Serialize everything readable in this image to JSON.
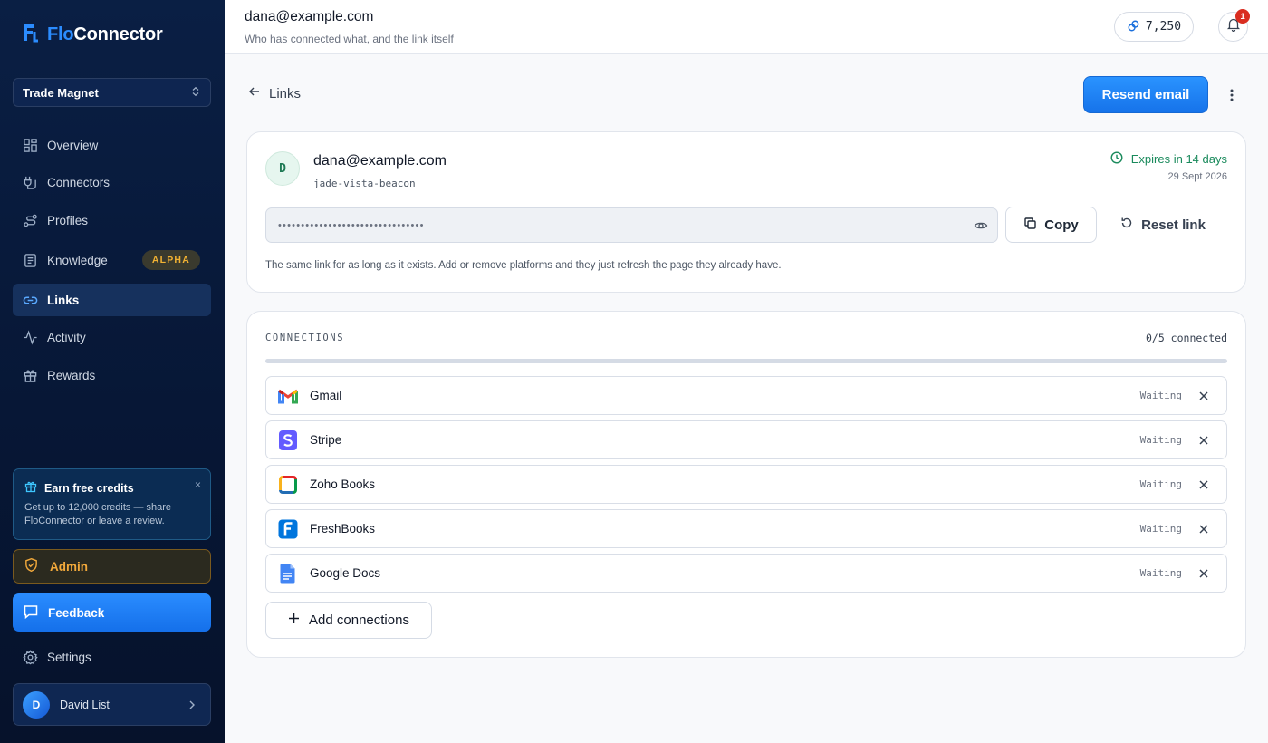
{
  "app": {
    "name_part1": "Flo",
    "name_part2": "Connector"
  },
  "sidebar": {
    "org": "Trade Magnet",
    "items": [
      {
        "label": "Overview",
        "icon": "grid-icon"
      },
      {
        "label": "Connectors",
        "icon": "plug-icon"
      },
      {
        "label": "Profiles",
        "icon": "route-icon"
      },
      {
        "label": "Knowledge",
        "icon": "book-icon",
        "badge": "ALPHA"
      },
      {
        "label": "Links",
        "icon": "link-icon",
        "active": true
      },
      {
        "label": "Activity",
        "icon": "activity-icon"
      },
      {
        "label": "Rewards",
        "icon": "gift-icon"
      }
    ],
    "credits_card": {
      "title": "Earn free credits",
      "body": "Get up to 12,000 credits — share FloConnector or leave a review."
    },
    "admin_label": "Admin",
    "feedback_label": "Feedback",
    "settings_label": "Settings",
    "user": {
      "initial": "D",
      "name": "David List"
    }
  },
  "topbar": {
    "title": "dana@example.com",
    "subtitle": "Who has connected what, and the link itself",
    "credits": "7,250",
    "notification_count": "1"
  },
  "main": {
    "back_label": "Links",
    "resend_label": "Resend email",
    "link_card": {
      "initial": "D",
      "email": "dana@example.com",
      "slug": "jade-vista-beacon",
      "expires_label": "Expires in 14 days",
      "expires_date": "29 Sept 2026",
      "secret_mask": "••••••••••••••••••••••••••••••••",
      "copy_label": "Copy",
      "reset_label": "Reset link",
      "help_text": "The same link for as long as it exists. Add or remove platforms and they just refresh the page they already have."
    },
    "connections": {
      "title": "CONNECTIONS",
      "count_label": "0/5 connected",
      "progress_fraction": 0,
      "items": [
        {
          "name": "Gmail",
          "status": "Waiting",
          "icon": "gmail-icon"
        },
        {
          "name": "Stripe",
          "status": "Waiting",
          "icon": "stripe-icon"
        },
        {
          "name": "Zoho Books",
          "status": "Waiting",
          "icon": "zoho-books-icon"
        },
        {
          "name": "FreshBooks",
          "status": "Waiting",
          "icon": "freshbooks-icon"
        },
        {
          "name": "Google Docs",
          "status": "Waiting",
          "icon": "google-docs-icon"
        }
      ],
      "add_label": "Add connections"
    }
  },
  "colors": {
    "accent": "#1a7cf5",
    "sidebar_bg": "#071736",
    "success": "#1a8a5c",
    "admin": "#f2a93b"
  }
}
